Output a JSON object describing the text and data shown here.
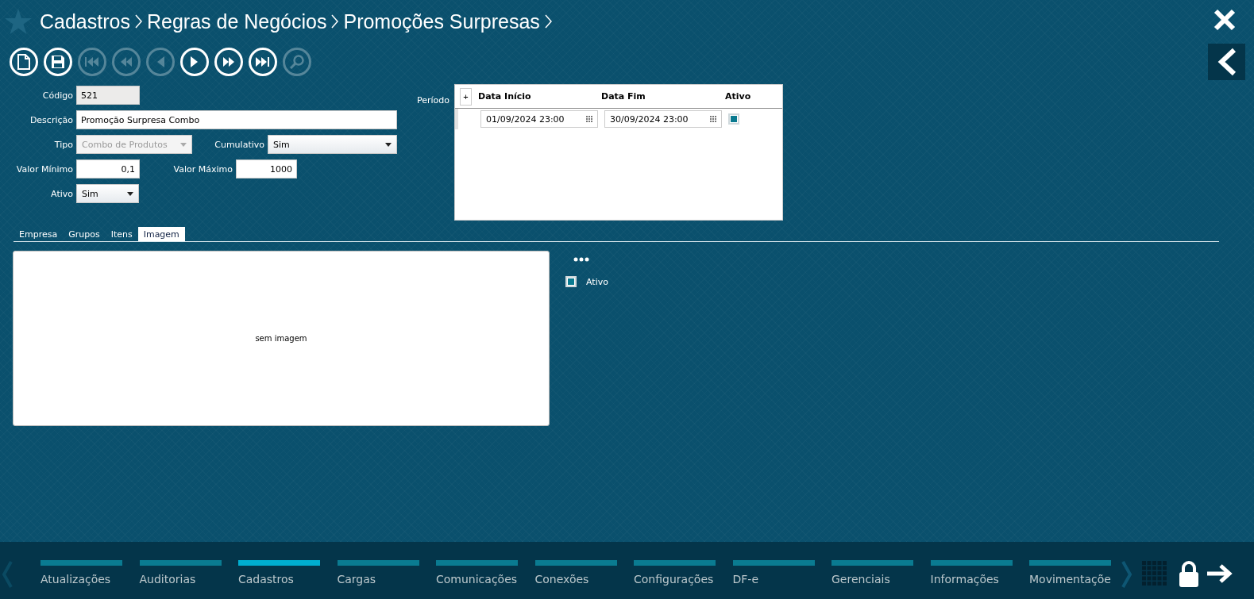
{
  "breadcrumb": [
    "Cadastros",
    "Regras de Negócios",
    "Promoções Surpresas"
  ],
  "toolbar": [
    {
      "kind": "new",
      "disabled": false
    },
    {
      "kind": "save",
      "disabled": false
    },
    {
      "kind": "first",
      "disabled": true
    },
    {
      "kind": "rewind",
      "disabled": true
    },
    {
      "kind": "previous",
      "disabled": true
    },
    {
      "kind": "next",
      "disabled": false
    },
    {
      "kind": "forward",
      "disabled": false
    },
    {
      "kind": "last",
      "disabled": false
    },
    {
      "kind": "search",
      "disabled": true
    }
  ],
  "form": {
    "codigo": {
      "label": "Código",
      "value": "521",
      "disabled": true
    },
    "descricao": {
      "label": "Descrição",
      "value": "Promoção Surpresa Combo"
    },
    "tipo": {
      "label": "Tipo",
      "value": "Combo de Produtos",
      "disabled": true
    },
    "cumulativo": {
      "label": "Cumulativo",
      "value": "Sim"
    },
    "valor_minimo": {
      "label": "Valor Mínimo",
      "value": "0,1"
    },
    "valor_maximo": {
      "label": "Valor Máximo",
      "value": "1000"
    },
    "ativo": {
      "label": "Ativo",
      "value": "Sim"
    }
  },
  "periodo": {
    "label": "Período",
    "add": "+",
    "columns": [
      "Data Início",
      "Data Fim",
      "Ativo"
    ],
    "rows": [
      {
        "start": "01/09/2024 23:00",
        "end": "30/09/2024 23:00",
        "active": true
      }
    ]
  },
  "tabs": [
    {
      "label": "Empresa",
      "selected": false
    },
    {
      "label": "Grupos",
      "selected": false
    },
    {
      "label": "Itens",
      "selected": false
    },
    {
      "label": "Imagem",
      "selected": true
    }
  ],
  "image_panel": {
    "empty_text": "sem imagem",
    "active": {
      "label": "Ativo",
      "checked": true
    }
  },
  "modules": [
    {
      "label": "Atualizações",
      "selected": false
    },
    {
      "label": "Auditorias",
      "selected": false
    },
    {
      "label": "Cadastros",
      "selected": true
    },
    {
      "label": "Cargas",
      "selected": false
    },
    {
      "label": "Comunicações",
      "selected": false
    },
    {
      "label": "Conexões",
      "selected": false
    },
    {
      "label": "Configurações",
      "selected": false
    },
    {
      "label": "DF-e",
      "selected": false
    },
    {
      "label": "Gerenciais",
      "selected": false
    },
    {
      "label": "Informações",
      "selected": false
    },
    {
      "label": "Movimentaçõe",
      "selected": false
    }
  ]
}
